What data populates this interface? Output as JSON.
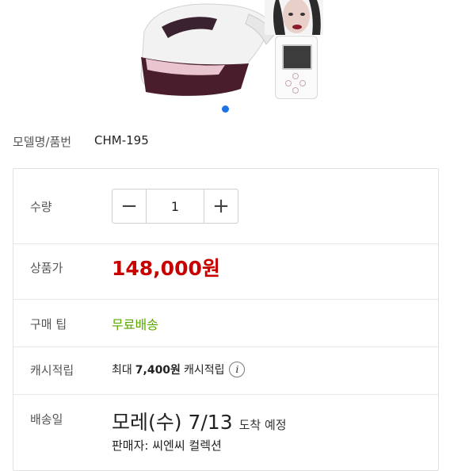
{
  "gallery": {
    "image_alt": "head massager product",
    "indicator_active": 1
  },
  "model": {
    "label": "모델명/품번",
    "value": "CHM-195"
  },
  "quantity": {
    "label": "수량",
    "minus": "−",
    "value": "1",
    "plus": "+"
  },
  "price": {
    "label": "상품가",
    "value": "148,000원"
  },
  "tip": {
    "label": "구매 팁",
    "value": "무료배송"
  },
  "cashback": {
    "label": "캐시적립",
    "prefix": "최대",
    "amount": "7,400원",
    "suffix": "캐시적립",
    "info": "i"
  },
  "delivery": {
    "label": "배송일",
    "date": "모레(수) 7/13",
    "note": "도착 예정",
    "seller": "판매자: 씨엔씨 컬렉션"
  },
  "colors": {
    "price": "#c70000",
    "shipping": "#5aa800",
    "indicator": "#1a73e8"
  }
}
